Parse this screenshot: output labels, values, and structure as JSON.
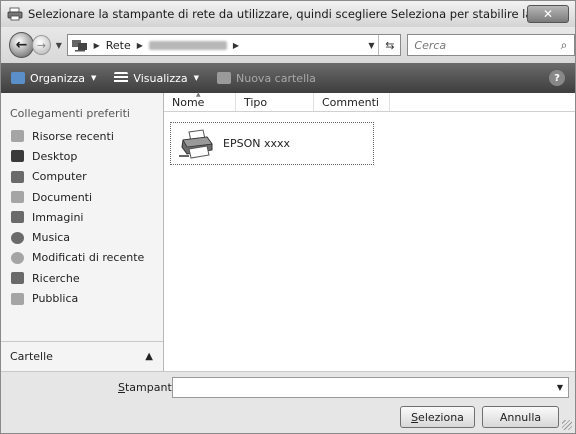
{
  "window": {
    "title": "Selezionare la stampante di rete da utilizzare, quindi scegliere Seleziona per stabilire la connessione",
    "close_label": "✕"
  },
  "address": {
    "root_label": "Rete",
    "search_placeholder": "Cerca"
  },
  "toolbar": {
    "organize_label": "Organizza",
    "view_label": "Visualizza",
    "new_folder_label": "Nuova cartella",
    "help_label": "?"
  },
  "sidebar": {
    "heading": "Collegamenti preferiti",
    "items": [
      {
        "label": "Risorse recenti",
        "icon": "recent-items-icon"
      },
      {
        "label": "Desktop",
        "icon": "desktop-icon"
      },
      {
        "label": "Computer",
        "icon": "computer-icon"
      },
      {
        "label": "Documenti",
        "icon": "documents-icon"
      },
      {
        "label": "Immagini",
        "icon": "pictures-icon"
      },
      {
        "label": "Musica",
        "icon": "music-icon"
      },
      {
        "label": "Modificati di recente",
        "icon": "recently-changed-icon"
      },
      {
        "label": "Ricerche",
        "icon": "searches-icon"
      },
      {
        "label": "Pubblica",
        "icon": "public-icon"
      }
    ],
    "folders_label": "Cartelle"
  },
  "columns": {
    "name": "Nome",
    "type": "Tipo",
    "comments": "Commenti"
  },
  "files": [
    {
      "name": "EPSON xxxx",
      "icon": "printer-icon"
    }
  ],
  "footer": {
    "printer_label_underlined": "S",
    "printer_label_rest": "tampante",
    "printer_value": "",
    "select_underlined": "S",
    "select_rest": "eleziona",
    "cancel_label": "Annulla"
  }
}
